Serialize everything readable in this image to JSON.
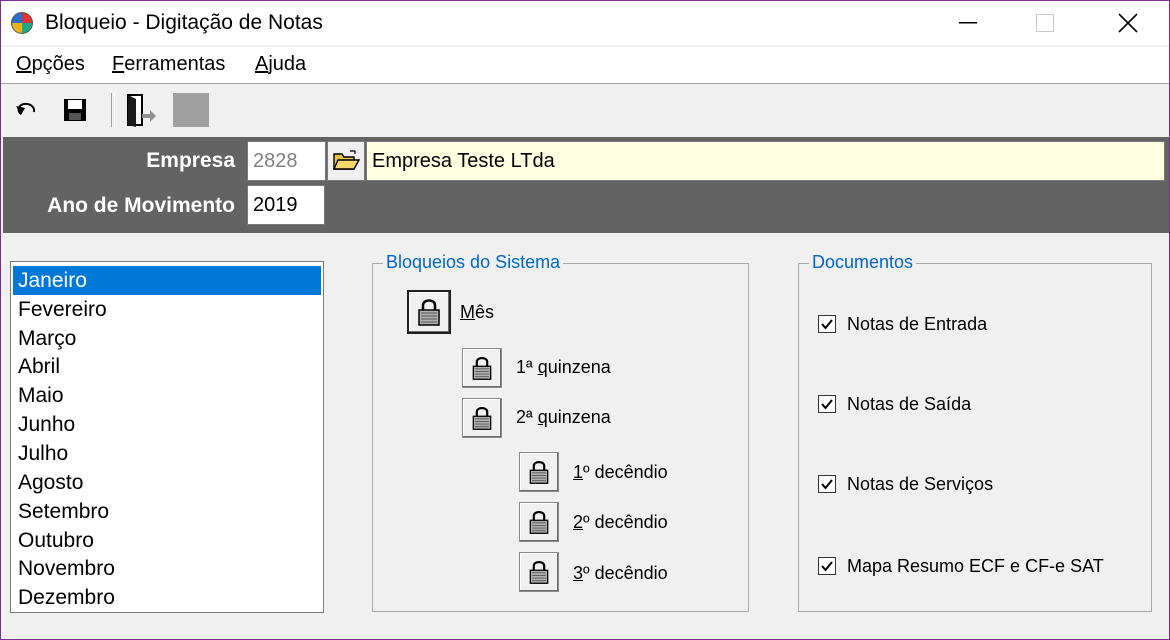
{
  "window": {
    "title": "Bloqueio - Digitação de Notas",
    "minimize": "—",
    "maximize": "☐",
    "close": "✕"
  },
  "menu": [
    {
      "first": "O",
      "rest": "pções"
    },
    {
      "first": "F",
      "rest": "erramentas"
    },
    {
      "first": "A",
      "rest": "juda"
    }
  ],
  "toolbar": {
    "icons": [
      "undo-icon",
      "save-icon",
      "exit-door-icon",
      "disabled-square-icon"
    ]
  },
  "header": {
    "empresa_label": "Empresa",
    "empresa_code": "2828",
    "empresa_name": "Empresa Teste LTda",
    "ano_label": "Ano de Movimento",
    "ano_value": "2019"
  },
  "months": {
    "selected_index": 0,
    "items": [
      "Janeiro",
      "Fevereiro",
      "Março",
      "Abril",
      "Maio",
      "Junho",
      "Julho",
      "Agosto",
      "Setembro",
      "Outubro",
      "Novembro",
      "Dezembro"
    ]
  },
  "bloqueios": {
    "title": "Bloqueios do Sistema",
    "mes": {
      "first": "M",
      "rest": "ês"
    },
    "quinzena1": {
      "pre": "1ª ",
      "first": "q",
      "rest": "uinzena"
    },
    "quinzena2": {
      "pre": "2ª ",
      "first": "q",
      "rest": "uinzena"
    },
    "decendio1": {
      "first": "1",
      "rest": "º decêndio"
    },
    "decendio2": {
      "first": "2",
      "rest": "º decêndio"
    },
    "decendio3": {
      "first": "3",
      "rest": "º decêndio"
    }
  },
  "documentos": {
    "title": "Documentos",
    "items": [
      {
        "label": "Notas de Entrada",
        "checked": true
      },
      {
        "label": "Notas de Saída",
        "checked": true
      },
      {
        "label": "Notas de Serviços",
        "checked": true
      },
      {
        "label": "Mapa Resumo ECF e CF-e SAT",
        "checked": true
      }
    ]
  },
  "colors": {
    "accent": "#0078d7",
    "header_panel": "#636363",
    "group_title": "#0066cc",
    "field_yellow": "#ffffe1"
  }
}
